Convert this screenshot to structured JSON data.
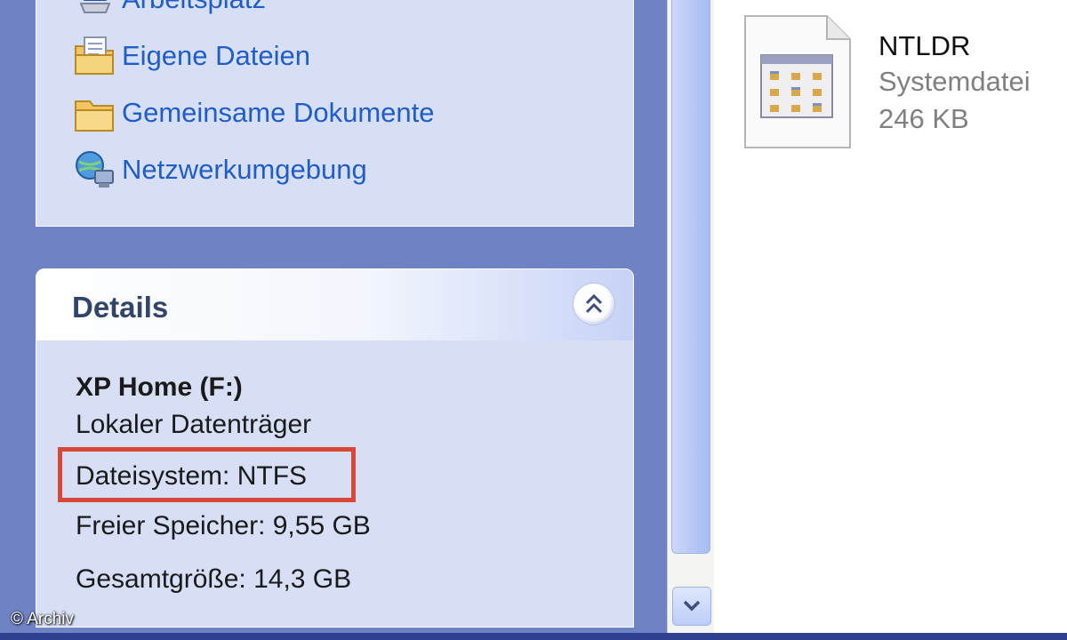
{
  "sidebar": {
    "places": [
      {
        "label": "Arbeitsplatz",
        "icon": "my-computer-icon"
      },
      {
        "label": "Eigene Dateien",
        "icon": "my-documents-icon"
      },
      {
        "label": "Gemeinsame Dokumente",
        "icon": "shared-documents-folder-icon"
      },
      {
        "label": "Netzwerkumgebung",
        "icon": "network-places-icon"
      }
    ]
  },
  "details": {
    "title": "Details",
    "drive_name": "XP Home (F:)",
    "drive_type": "Lokaler Datenträger",
    "filesystem": "Dateisystem: NTFS",
    "free_space": "Freier Speicher: 9,55 GB",
    "total_size": "Gesamtgröße: 14,3 GB",
    "collapse_icon": "double-chevron-up-icon"
  },
  "file": {
    "name": "NTLDR",
    "type": "Systemdatei",
    "size": "246 KB",
    "icon": "system-file-icon"
  },
  "scrollbar": {
    "down_icon": "chevron-down-icon"
  },
  "watermark": "© Archiv",
  "colors": {
    "taskpane_bg": "#6f82c3",
    "box_bg": "#d6dff5",
    "link": "#215dc6",
    "title": "#31456b",
    "highlight": "#d9473a"
  }
}
